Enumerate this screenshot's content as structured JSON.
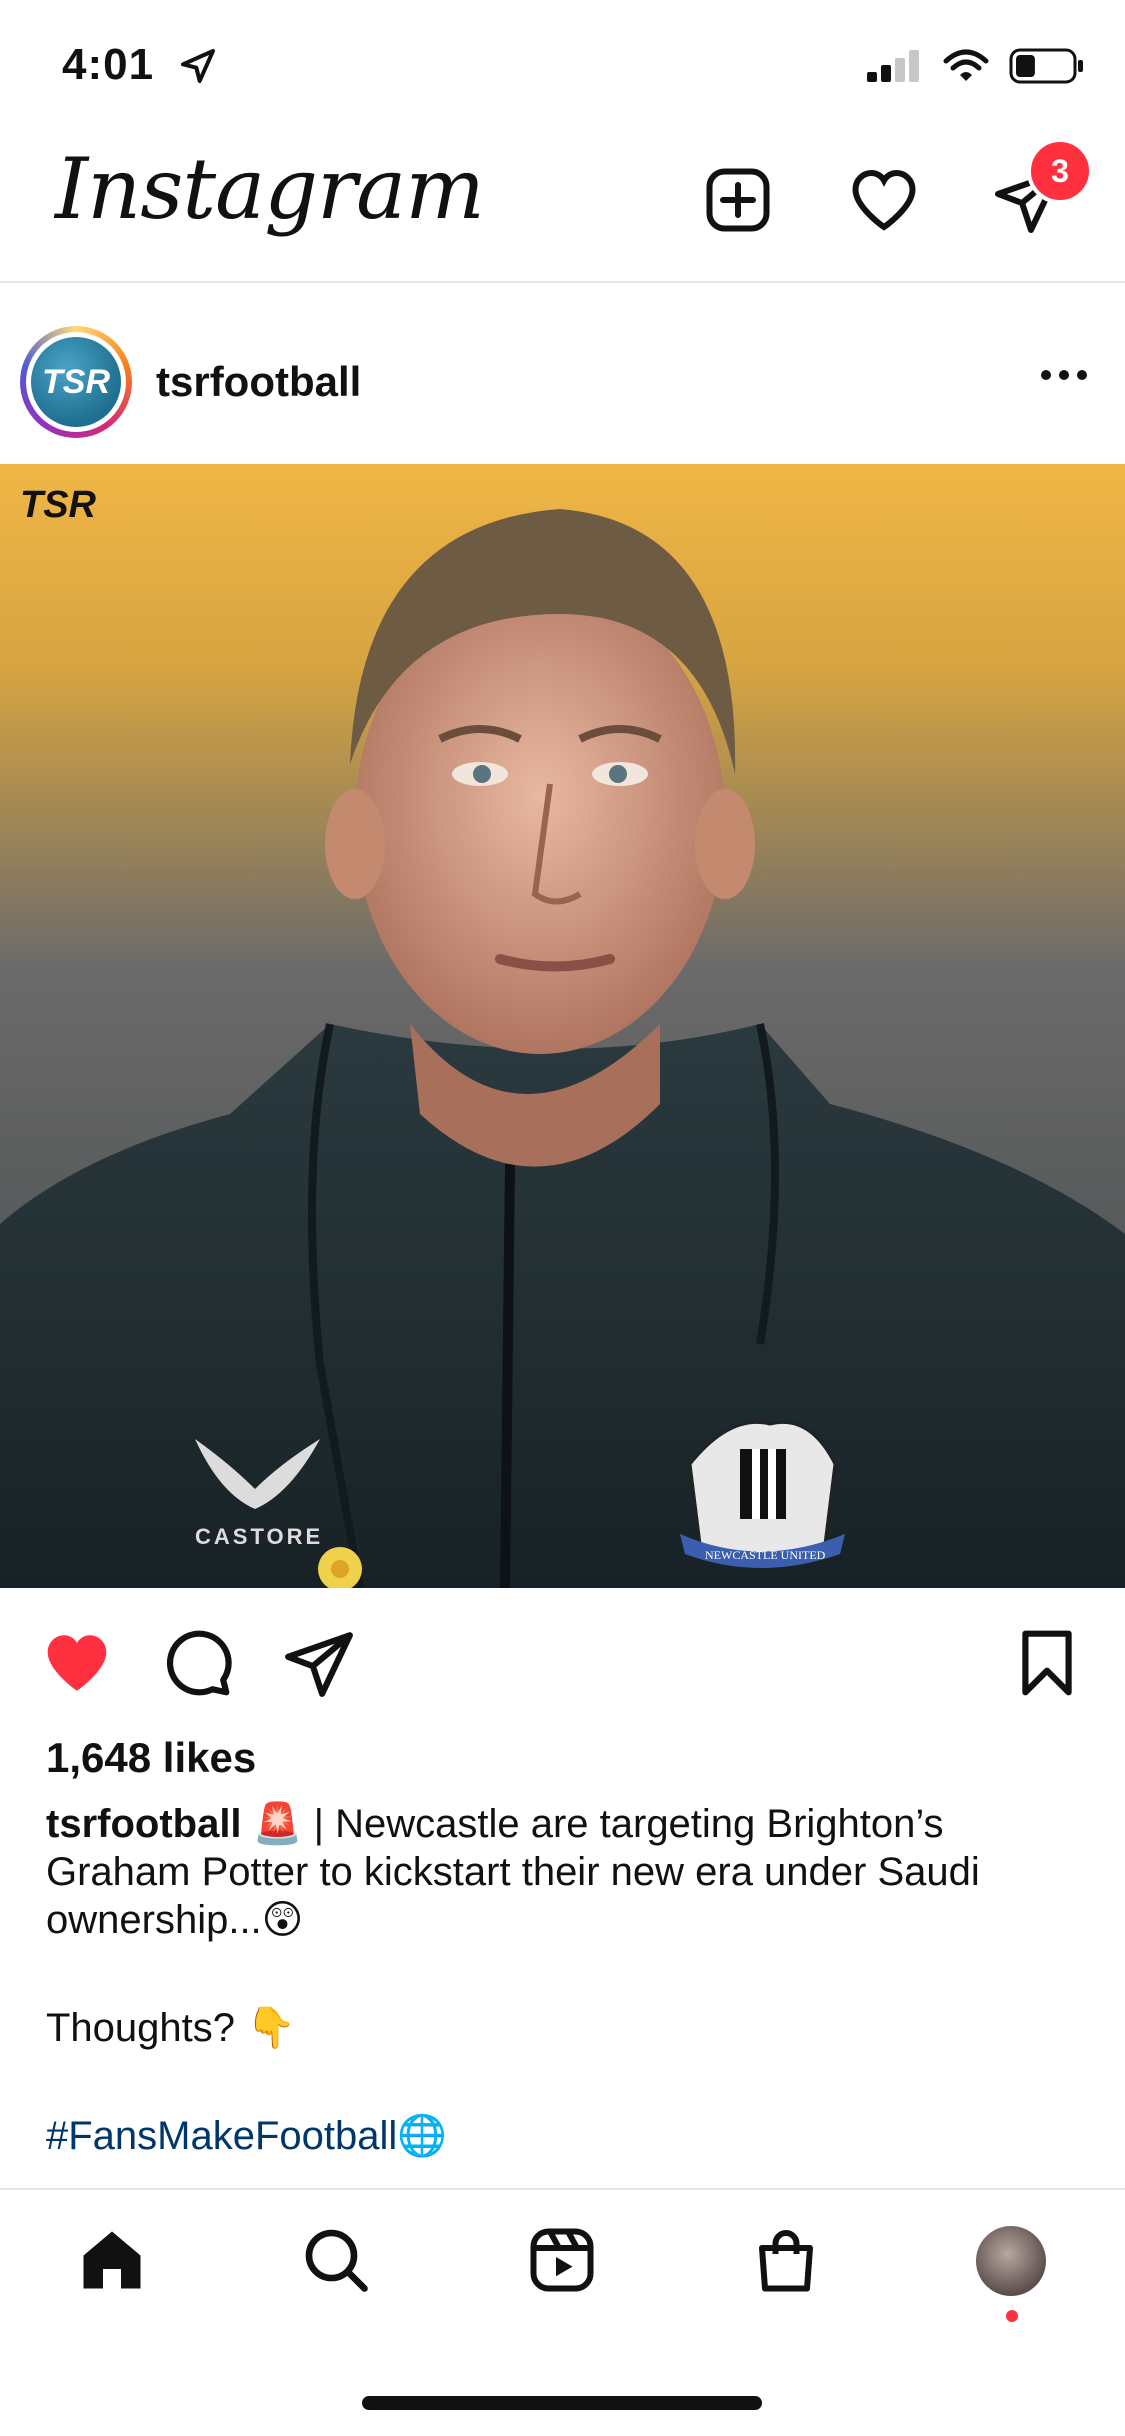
{
  "status_bar": {
    "time": "4:01",
    "battery_level": 0.35
  },
  "header": {
    "logo_text": "Instagram",
    "icons": [
      "add-post-icon",
      "heart-icon",
      "direct-messages-icon"
    ],
    "messages_badge": "3"
  },
  "post": {
    "username": "tsrfootball",
    "avatar_text": "TSR",
    "watermark": "TSR",
    "photo_text": {
      "brand": "CASTORE",
      "crest": "NEWCASTLE UNITED"
    },
    "liked": true,
    "likes_text": "1,648 likes",
    "caption": {
      "author": "tsrfootball",
      "text": " 🚨 | Newcastle are targeting Brighton’s Graham Potter to kickstart their new era under Saudi ownership...😲",
      "line2": "Thoughts? 👇",
      "hashtag": "#FansMakeFootball🌐"
    }
  },
  "bottom_nav": {
    "items": [
      "home-icon",
      "search-icon",
      "reels-icon",
      "shop-icon",
      "profile-avatar"
    ]
  },
  "colors": {
    "like": "#ff3040",
    "badge": "#ff3040",
    "hashtag": "#00376b"
  }
}
